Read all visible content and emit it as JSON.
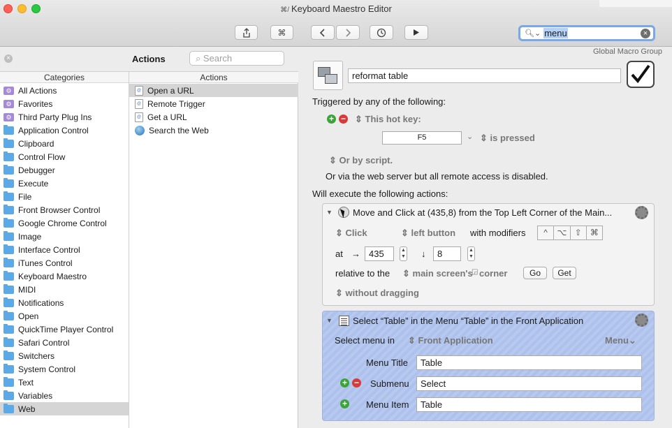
{
  "window": {
    "title": "Keyboard Maestro Editor",
    "title_glyph": "⌘/"
  },
  "toolbar": {
    "share_icon": "share-icon",
    "command_icon": "⌘",
    "back_icon": "‹",
    "forward_icon": "›",
    "history_icon": "clock-icon",
    "run_icon": "play-icon"
  },
  "top_search": {
    "value": "menu"
  },
  "actions_panel": {
    "title": "Actions",
    "search_placeholder": "Search",
    "categories_header": "Categories",
    "actions_header": "Actions",
    "categories": [
      {
        "label": "All Actions",
        "type": "smart"
      },
      {
        "label": "Favorites",
        "type": "smart"
      },
      {
        "label": "Third Party Plug Ins",
        "type": "smart"
      },
      {
        "label": "Application Control",
        "type": "folder"
      },
      {
        "label": "Clipboard",
        "type": "folder"
      },
      {
        "label": "Control Flow",
        "type": "folder"
      },
      {
        "label": "Debugger",
        "type": "folder"
      },
      {
        "label": "Execute",
        "type": "folder"
      },
      {
        "label": "File",
        "type": "folder"
      },
      {
        "label": "Front Browser Control",
        "type": "folder"
      },
      {
        "label": "Google Chrome Control",
        "type": "folder"
      },
      {
        "label": "Image",
        "type": "folder"
      },
      {
        "label": "Interface Control",
        "type": "folder"
      },
      {
        "label": "iTunes Control",
        "type": "folder"
      },
      {
        "label": "Keyboard Maestro",
        "type": "folder"
      },
      {
        "label": "MIDI",
        "type": "folder"
      },
      {
        "label": "Notifications",
        "type": "folder"
      },
      {
        "label": "Open",
        "type": "folder"
      },
      {
        "label": "QuickTime Player Control",
        "type": "folder"
      },
      {
        "label": "Safari Control",
        "type": "folder"
      },
      {
        "label": "Switchers",
        "type": "folder"
      },
      {
        "label": "System Control",
        "type": "folder"
      },
      {
        "label": "Text",
        "type": "folder"
      },
      {
        "label": "Variables",
        "type": "folder"
      },
      {
        "label": "Web",
        "type": "folder",
        "selected": true
      }
    ],
    "actions": [
      {
        "label": "Open a URL",
        "icon": "doc",
        "selected": true
      },
      {
        "label": "Remote Trigger",
        "icon": "doc"
      },
      {
        "label": "Get a URL",
        "icon": "doc"
      },
      {
        "label": "Search the Web",
        "icon": "globe"
      }
    ]
  },
  "macro": {
    "group_label": "Global Macro Group",
    "name": "reformat table",
    "triggered_label": "Triggered by any of the following:",
    "hotkey_label": "This hot key:",
    "hotkey_value": "F5",
    "hotkey_state": "is pressed",
    "script_label": "Or by script.",
    "web_label": "Or via the web server but all remote access is disabled.",
    "execute_label": "Will execute the following actions:",
    "action1": {
      "title": "Move and Click at (435,8) from the Top Left Corner of the Main...",
      "click_label": "Click",
      "button_label": "left button",
      "modifiers_label": "with modifiers",
      "modifiers": [
        "^",
        "⌥",
        "⇧",
        "⌘"
      ],
      "at_label": "at",
      "x_arrow": "→",
      "x_value": "435",
      "y_arrow": "↓",
      "y_value": "8",
      "relative_label": "relative to the",
      "screen_label": "main screen's",
      "corner_label": "corner",
      "go_label": "Go",
      "get_label": "Get",
      "drag_label": "without dragging"
    },
    "action2": {
      "title": "Select “Table” in the Menu “Table” in the Front Application",
      "select_label": "Select menu in",
      "app_label": "Front Application",
      "menu_dropdown": "Menu",
      "menu_title_label": "Menu Title",
      "menu_title_value": "Table",
      "submenu_label": "Submenu",
      "submenu_value": "Select",
      "menu_item_label": "Menu Item",
      "menu_item_value": "Table"
    }
  }
}
